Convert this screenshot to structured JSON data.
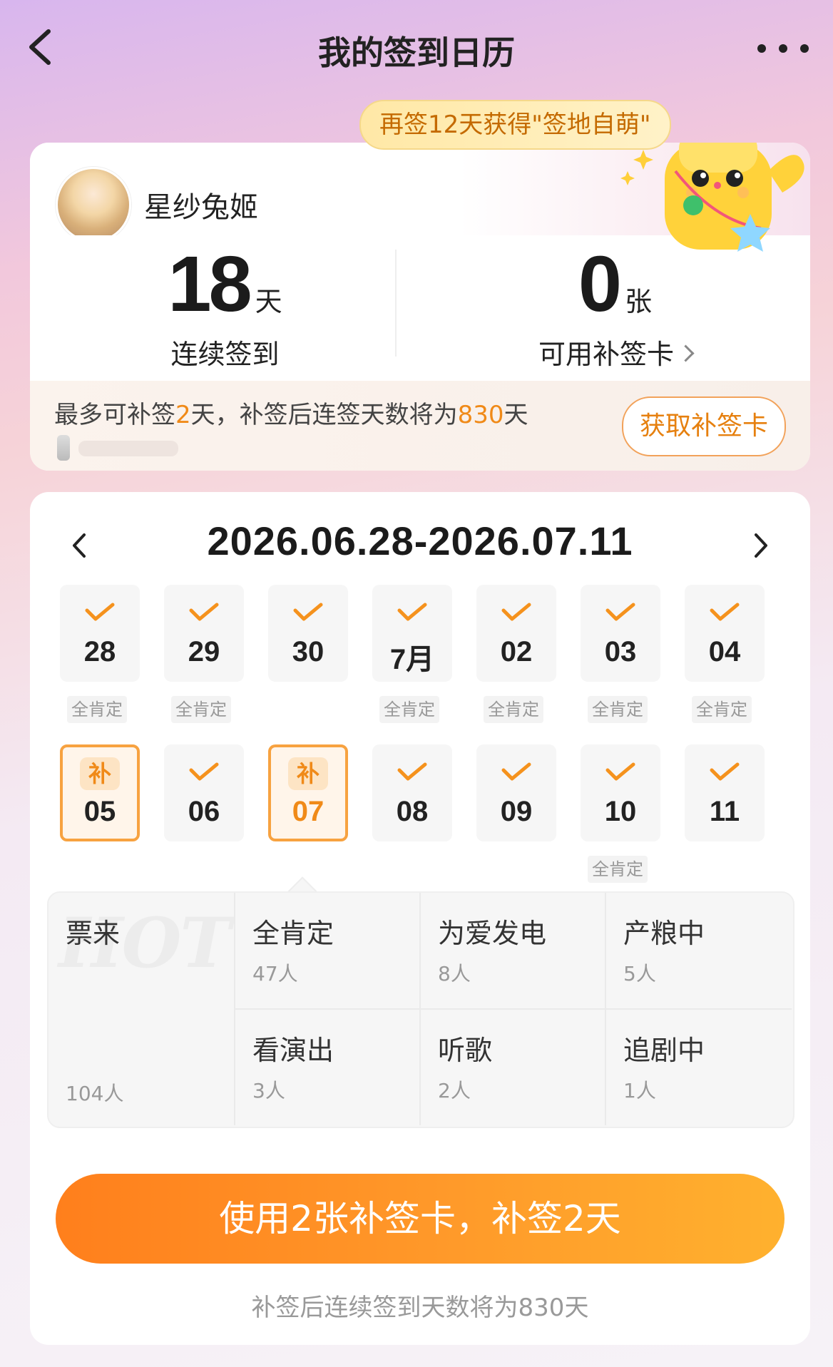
{
  "nav": {
    "title": "我的签到日历"
  },
  "promo": {
    "text": "再签12天获得\"签地自萌\""
  },
  "profile": {
    "username": "星纱兔姬",
    "streak": {
      "value": "18",
      "unit": "天",
      "label": "连续签到"
    },
    "cards": {
      "value": "0",
      "unit": "张",
      "label": "可用补签卡"
    },
    "makeup_note": {
      "prefix": "最多可补签",
      "days": "2",
      "middle": "天，补签后连签天数将为",
      "total": "830",
      "suffix": "天"
    },
    "get_card_button": "获取补签卡"
  },
  "calendar": {
    "range": "2026.06.28-2026.07.11",
    "week1": [
      {
        "label": "28",
        "tag": "全肯定"
      },
      {
        "label": "29",
        "tag": "全肯定"
      },
      {
        "label": "30",
        "tag": ""
      },
      {
        "label": "7月",
        "tag": "全肯定"
      },
      {
        "label": "02",
        "tag": "全肯定"
      },
      {
        "label": "03",
        "tag": "全肯定"
      },
      {
        "label": "04",
        "tag": "全肯定"
      }
    ],
    "week2": [
      {
        "label": "05",
        "makeup": true,
        "tag": ""
      },
      {
        "label": "06",
        "tag": ""
      },
      {
        "label": "07",
        "makeup": true,
        "selected": true,
        "tag": ""
      },
      {
        "label": "08",
        "tag": ""
      },
      {
        "label": "09",
        "tag": ""
      },
      {
        "label": "10",
        "tag": "全肯定"
      },
      {
        "label": "11",
        "tag": ""
      }
    ],
    "makeup_badge": "补"
  },
  "tags": {
    "hot_watermark": "HOT",
    "items": [
      {
        "name": "票来",
        "count": "104人"
      },
      {
        "name": "全肯定",
        "count": "47人"
      },
      {
        "name": "为爱发电",
        "count": "8人"
      },
      {
        "name": "产粮中",
        "count": "5人"
      },
      {
        "name": "看演出",
        "count": "3人"
      },
      {
        "name": "听歌",
        "count": "2人"
      },
      {
        "name": "追剧中",
        "count": "1人"
      }
    ]
  },
  "cta": {
    "button": "使用2张补签卡，补签2天",
    "note": "补签后连续签到天数将为830天"
  },
  "colors": {
    "accent": "#f08a18",
    "cta_start": "#ff7f1c",
    "cta_end": "#ffb12e"
  }
}
